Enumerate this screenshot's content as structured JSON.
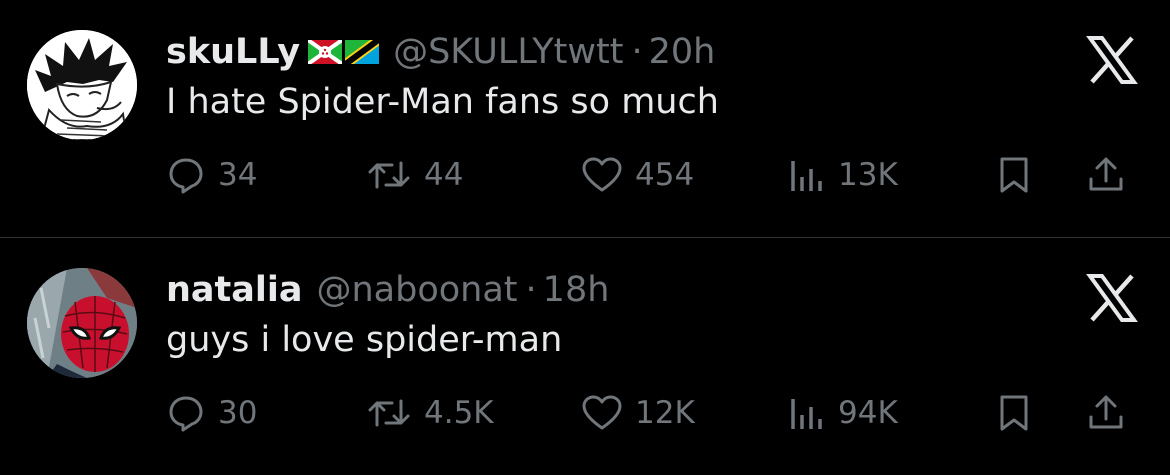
{
  "colors": {
    "background": "#000000",
    "primary_text": "#e7e9ea",
    "secondary_text": "#71767b",
    "divider": "#2f3336"
  },
  "tweets": [
    {
      "display_name": "skuLLy",
      "flags": [
        "flag-burundi-icon",
        "flag-tanzania-icon"
      ],
      "handle": "@SKULLYtwtt",
      "separator": "·",
      "time": "20h",
      "text": "I hate Spider-Man fans so much",
      "replies": "34",
      "retweets": "44",
      "likes": "454",
      "views": "13K",
      "icons": {
        "avatar": "manga-character-avatar",
        "close": "x-logo-icon",
        "reply": "speech-bubble-icon",
        "retweet": "retweet-arrows-icon",
        "like": "heart-icon",
        "views": "bar-chart-icon",
        "bookmark": "bookmark-icon",
        "share": "share-upload-icon"
      }
    },
    {
      "display_name": "natalia",
      "handle": "@naboonat",
      "separator": "·",
      "time": "18h",
      "text": "guys i love spider-man",
      "replies": "30",
      "retweets": "4.5K",
      "likes": "12K",
      "views": "94K",
      "icons": {
        "avatar": "spider-man-avatar",
        "close": "x-logo-icon",
        "reply": "speech-bubble-icon",
        "retweet": "retweet-arrows-icon",
        "like": "heart-icon",
        "views": "bar-chart-icon",
        "bookmark": "bookmark-icon",
        "share": "share-upload-icon"
      }
    }
  ]
}
